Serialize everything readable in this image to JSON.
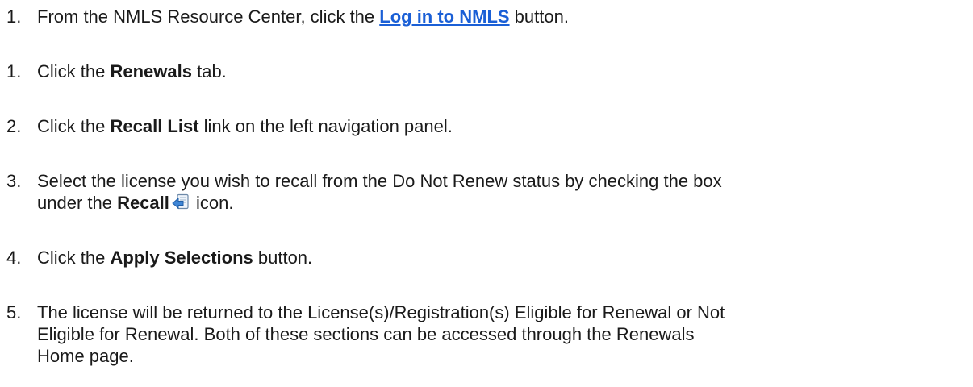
{
  "steps": [
    {
      "number": "1.",
      "before": "From the NMLS Resource Center, click the ",
      "link": "Log in to NMLS",
      "after": " button."
    },
    {
      "number": "1.",
      "before": "Click the ",
      "bold": "Renewals",
      "after": " tab."
    },
    {
      "number": "2.",
      "before": "Click the ",
      "bold": "Recall List",
      "after": " link on the left navigation panel."
    },
    {
      "number": "3.",
      "line1": "Select the license you wish to recall from the Do Not Renew status by checking the box",
      "line2_before": "under the ",
      "bold": "Recall",
      "icon": "recall-icon",
      "after": " icon."
    },
    {
      "number": "4.",
      "before": "Click the ",
      "bold": "Apply Selections",
      "after": " button."
    },
    {
      "number": "5.",
      "line1": "The license will be returned to the License(s)/Registration(s) Eligible for Renewal or Not",
      "line2": "Eligible for Renewal. Both of these sections can be accessed through the Renewals",
      "line3": "Home page."
    }
  ],
  "colors": {
    "link": "#1a5fd6",
    "text": "#1a1a1a"
  }
}
